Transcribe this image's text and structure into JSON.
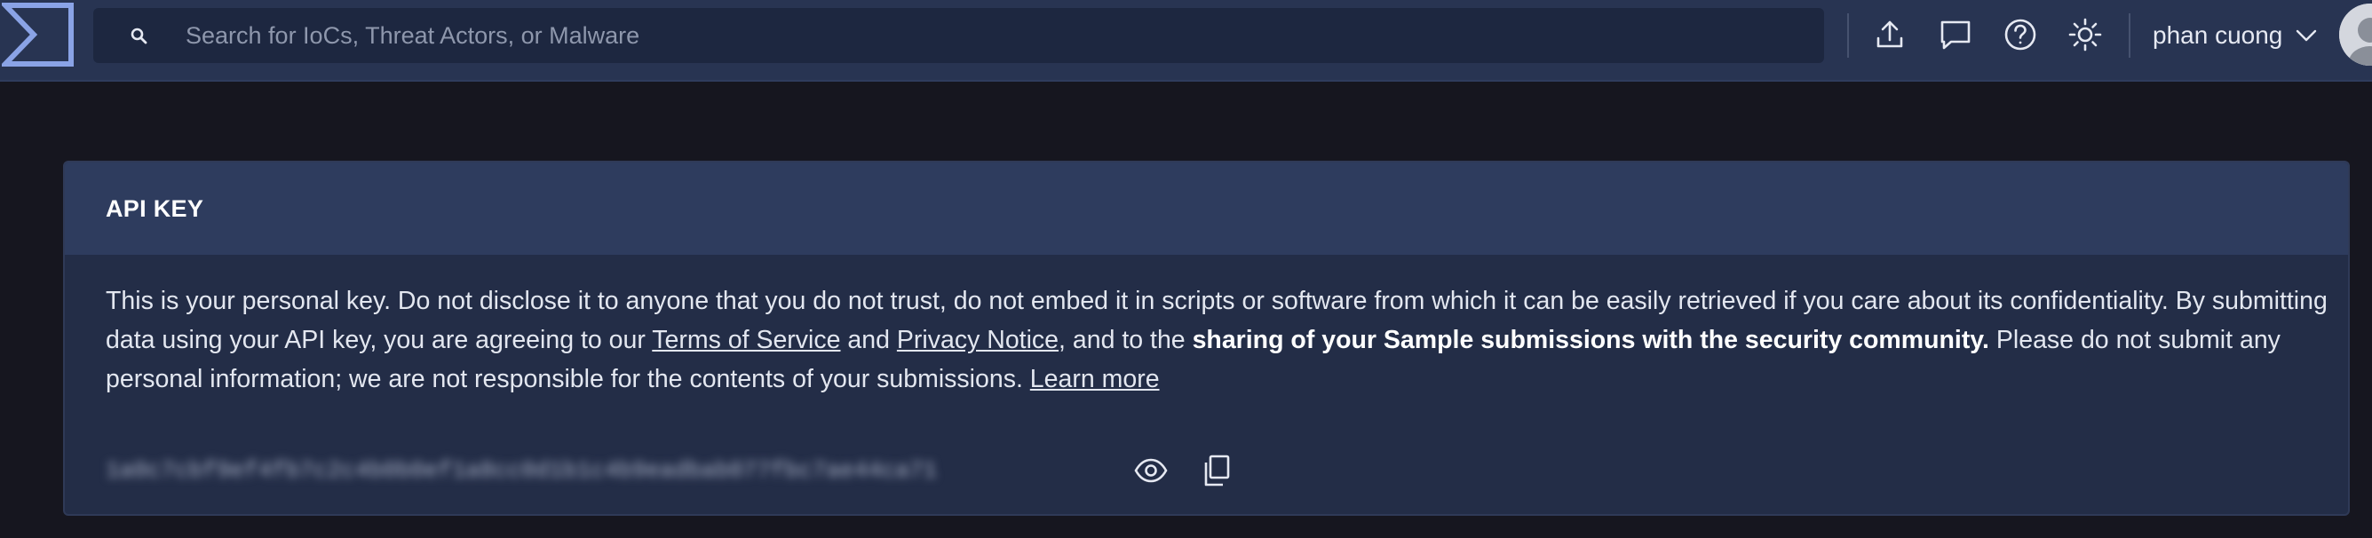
{
  "app": {
    "logo_icon": "sigma-logo-icon"
  },
  "search": {
    "placeholder": "Search for IoCs, Threat Actors, or Malware",
    "value": ""
  },
  "header_actions": [
    {
      "icon": "upload-icon"
    },
    {
      "icon": "comment-icon"
    },
    {
      "icon": "help-icon"
    },
    {
      "icon": "theme-toggle-icon"
    }
  ],
  "user": {
    "name": "phan cuong",
    "menu_icon": "chevron-down-icon"
  },
  "api_key_card": {
    "title": "API KEY",
    "description": {
      "part1": "This is your personal key. Do not disclose it to anyone that you do not trust, do not embed it in scripts or software from which it can be easily retrieved if you care about its confidentiality. By submitting data using your API key, you are agreeing to our ",
      "terms_link": "Terms of Service",
      "part2": " and ",
      "privacy_link": "Privacy Notice",
      "part3": ", and to the ",
      "bold_text": "sharing of your Sample submissions with the security community.",
      "part4": " Please do not submit any personal information; we are not responsible for the contents of your submissions. ",
      "learn_more_link": "Learn more"
    },
    "key_value": "1a0c7cbf9ef4fb7c2c4b0b0ef1a8cc0d1b1c4b9eadbab077fbc7ae44ca71",
    "show_icon": "eye-icon",
    "copy_icon": "copy-icon"
  },
  "colors": {
    "background": "#16161f",
    "topbar": "#283452",
    "search_bg": "#1d2740",
    "card_bg": "#232d47",
    "card_header_bg": "#2e3c5e",
    "logo_accent": "#8aa3e6"
  }
}
